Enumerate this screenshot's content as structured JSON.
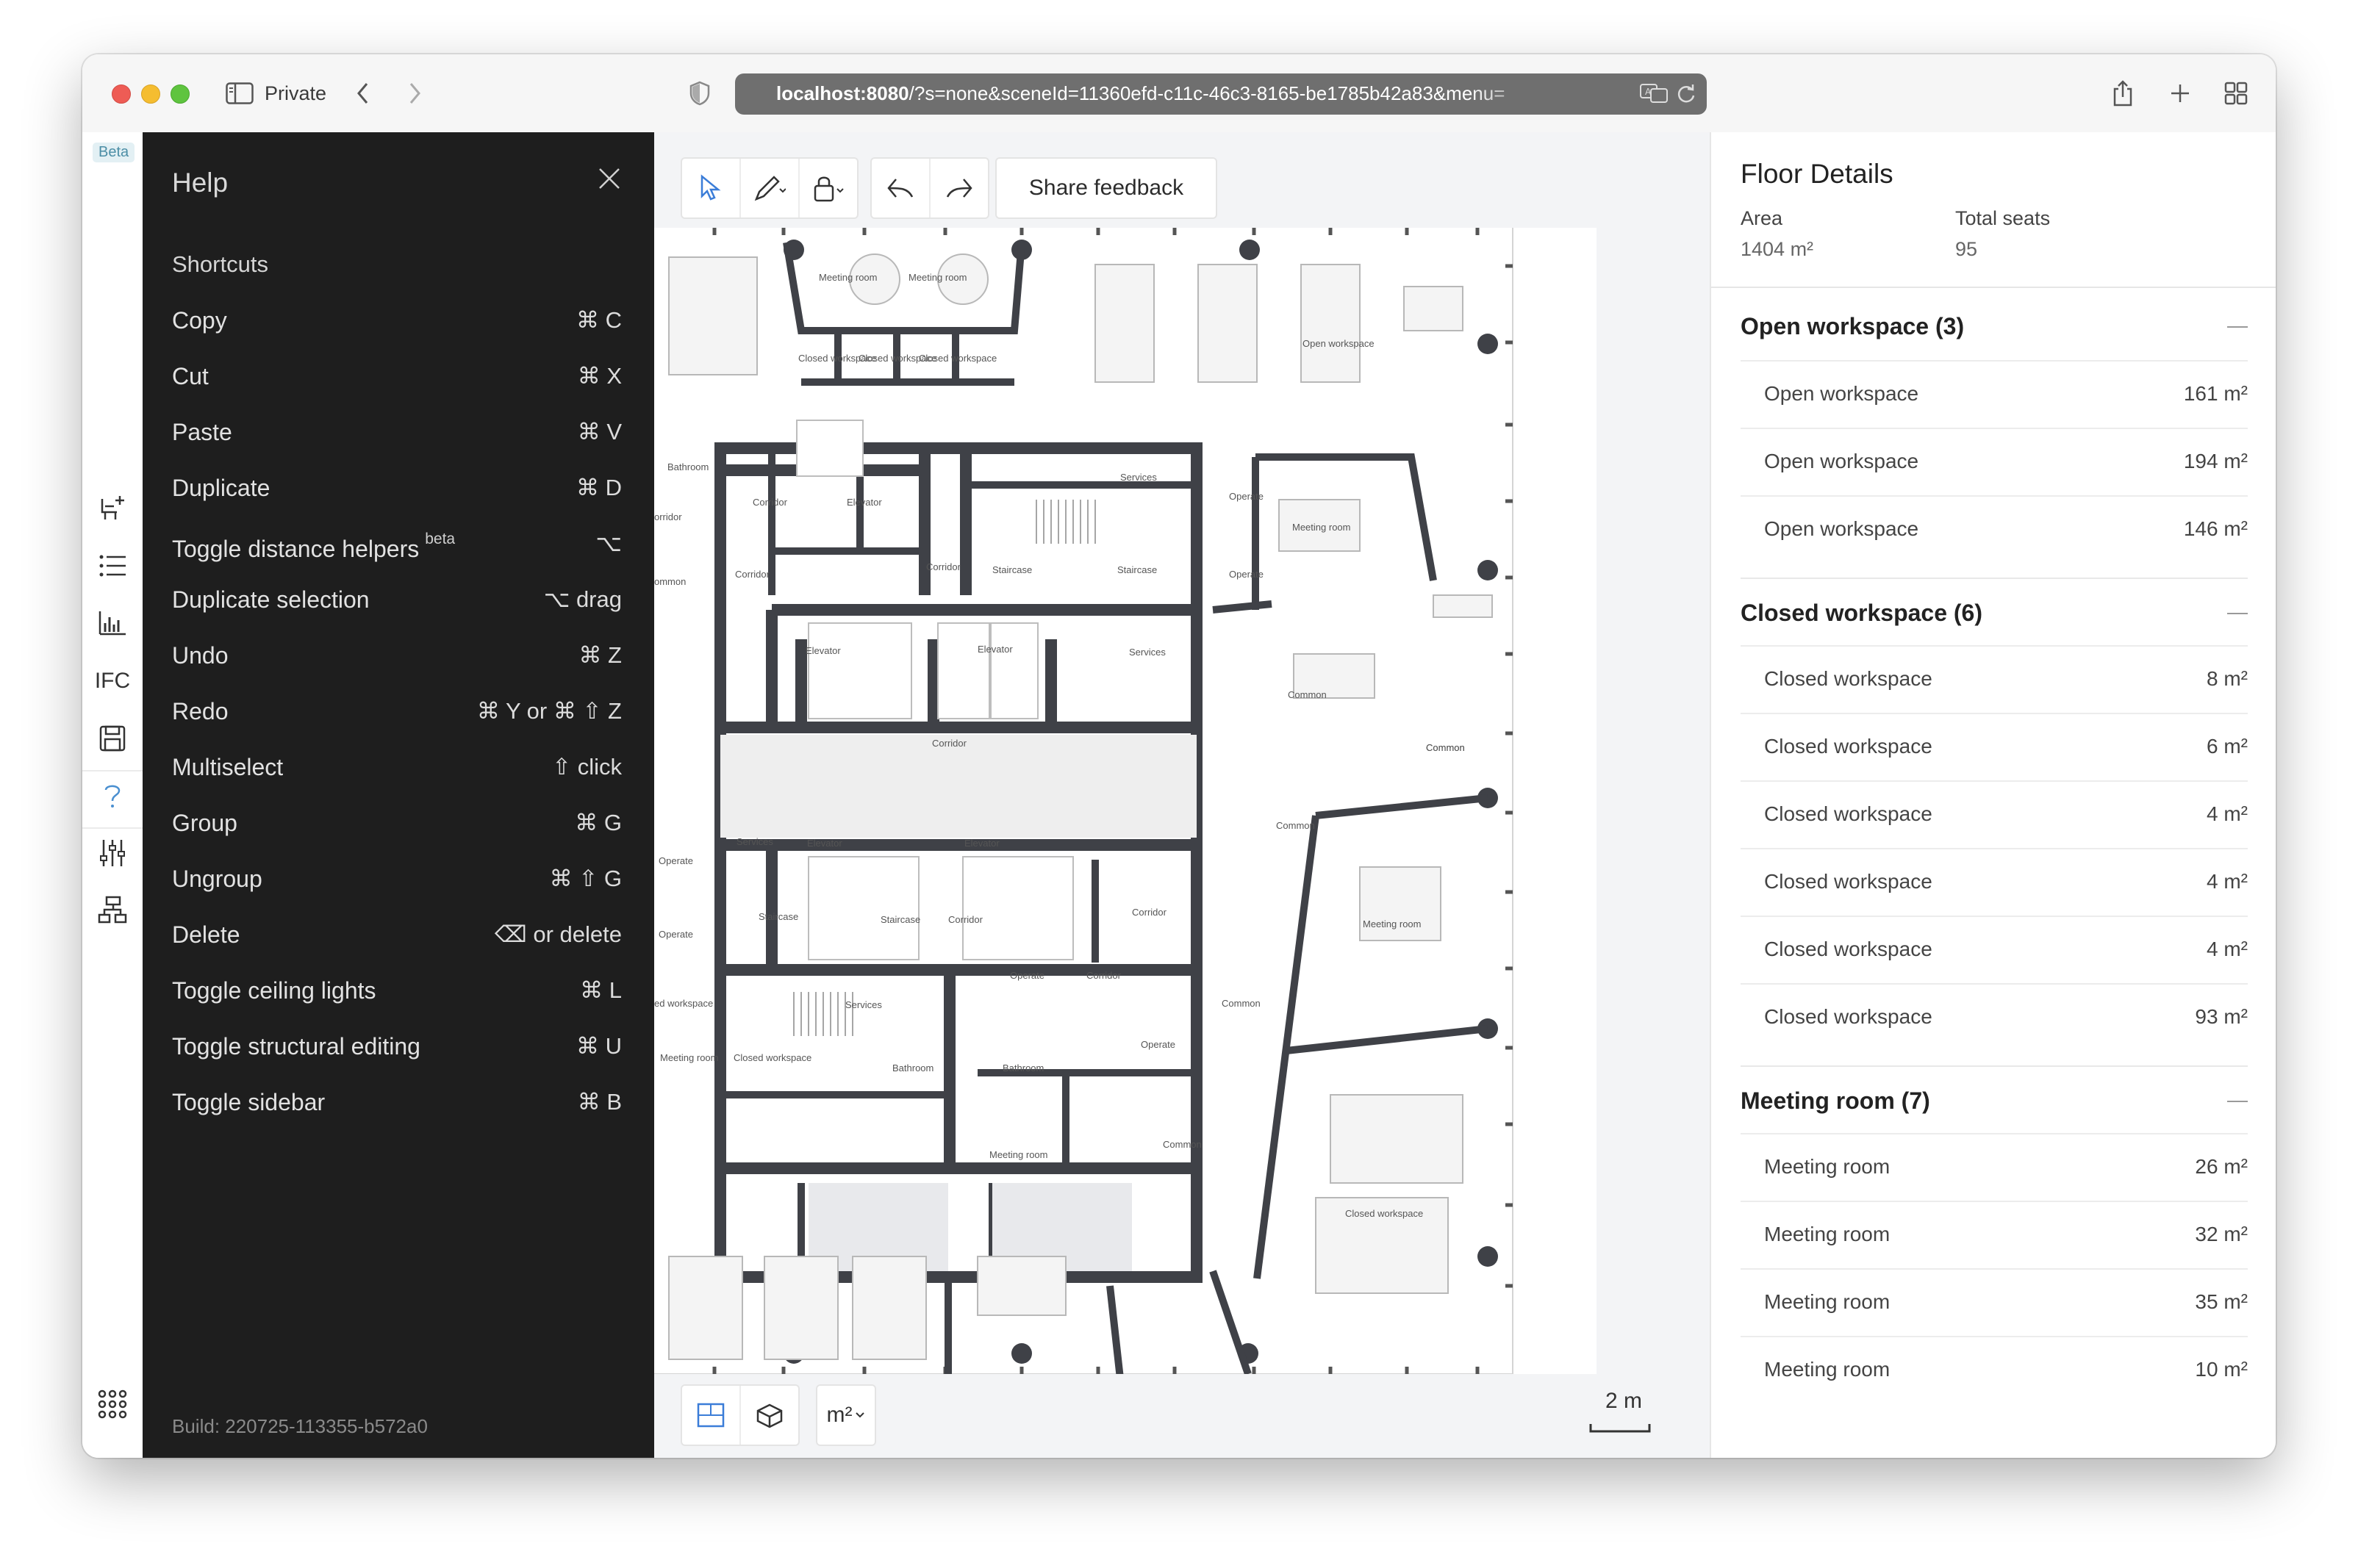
{
  "browser": {
    "mode_label": "Private",
    "url_host": "localhost:8080",
    "url_rest": "/?s=none&sceneId=11360efd-c11c-46c3-8165-be1785b42a83&menu="
  },
  "rail": {
    "beta_badge": "Beta",
    "ifc_label": "IFC",
    "items": [
      "add-furniture-icon",
      "list-icon",
      "chart-icon",
      "ifc",
      "save-icon",
      "help-icon",
      "sliders-icon",
      "hierarchy-icon",
      "apps-grid-icon"
    ]
  },
  "help": {
    "title": "Help",
    "section": "Shortcuts",
    "shortcuts": [
      {
        "label": "Copy",
        "keys": "⌘ C"
      },
      {
        "label": "Cut",
        "keys": "⌘ X"
      },
      {
        "label": "Paste",
        "keys": "⌘ V"
      },
      {
        "label": "Duplicate",
        "keys": "⌘ D"
      },
      {
        "label": "Toggle distance helpers",
        "sup": "beta",
        "keys": "⌥"
      },
      {
        "label": "Duplicate selection",
        "keys": "⌥ drag"
      },
      {
        "label": "Undo",
        "keys": "⌘ Z"
      },
      {
        "label": "Redo",
        "keys": "⌘ Y   or   ⌘ ⇧ Z"
      },
      {
        "label": "Multiselect",
        "keys": "⇧ click"
      },
      {
        "label": "Group",
        "keys": "⌘ G"
      },
      {
        "label": "Ungroup",
        "keys": "⌘ ⇧ G"
      },
      {
        "label": "Delete",
        "keys": "⌫   or   delete"
      },
      {
        "label": "Toggle ceiling lights",
        "keys": "⌘ L"
      },
      {
        "label": "Toggle structural editing",
        "keys": "⌘ U"
      },
      {
        "label": "Toggle sidebar",
        "keys": "⌘ B"
      }
    ],
    "build": "Build: 220725-113355-b572a0"
  },
  "toolbar": {
    "feedback_label": "Share feedback",
    "unit_label": "m²",
    "scale_label": "2 m"
  },
  "plan": {
    "room_labels": [
      "Meeting room",
      "Meeting room",
      "Closed workspace",
      "Closed workspace",
      "Closed workspace",
      "Open workspace",
      "Bathroom",
      "Corridor",
      "Elevator",
      "Services",
      "Operate",
      "Meeting room",
      "Corridor",
      "Corridor",
      "Staircase",
      "Staircase",
      "Operate",
      "Common",
      "Elevator",
      "Elevator",
      "Services",
      "Common",
      "Corridor",
      "Common",
      "Services",
      "Elevator",
      "Elevator",
      "Operate",
      "Staircase",
      "Staircase",
      "Corridor",
      "Corridor",
      "Meeting room",
      "Operate",
      "Operate",
      "Corridor",
      "Services",
      "Common",
      "Meeting room",
      "Closed workspace",
      "Bathroom",
      "Bathroom",
      "Operate",
      "Meeting room",
      "Common",
      "Closed workspace",
      "Common",
      "ommon",
      "orridor",
      "ed workspace"
    ]
  },
  "floor": {
    "title": "Floor Details",
    "area_label": "Area",
    "area_value": "1404 m²",
    "seats_label": "Total seats",
    "seats_value": "95",
    "sections": [
      {
        "title": "Open workspace (3)",
        "items": [
          {
            "name": "Open workspace",
            "area": "161 m²"
          },
          {
            "name": "Open workspace",
            "area": "194 m²"
          },
          {
            "name": "Open workspace",
            "area": "146 m²"
          }
        ]
      },
      {
        "title": "Closed workspace (6)",
        "items": [
          {
            "name": "Closed workspace",
            "area": "8 m²"
          },
          {
            "name": "Closed workspace",
            "area": "6 m²"
          },
          {
            "name": "Closed workspace",
            "area": "4 m²"
          },
          {
            "name": "Closed workspace",
            "area": "4 m²"
          },
          {
            "name": "Closed workspace",
            "area": "4 m²"
          },
          {
            "name": "Closed workspace",
            "area": "93 m²"
          }
        ]
      },
      {
        "title": "Meeting room (7)",
        "items": [
          {
            "name": "Meeting room",
            "area": "26 m²"
          },
          {
            "name": "Meeting room",
            "area": "32 m²"
          },
          {
            "name": "Meeting room",
            "area": "35 m²"
          },
          {
            "name": "Meeting room",
            "area": "10 m²"
          }
        ]
      }
    ]
  }
}
